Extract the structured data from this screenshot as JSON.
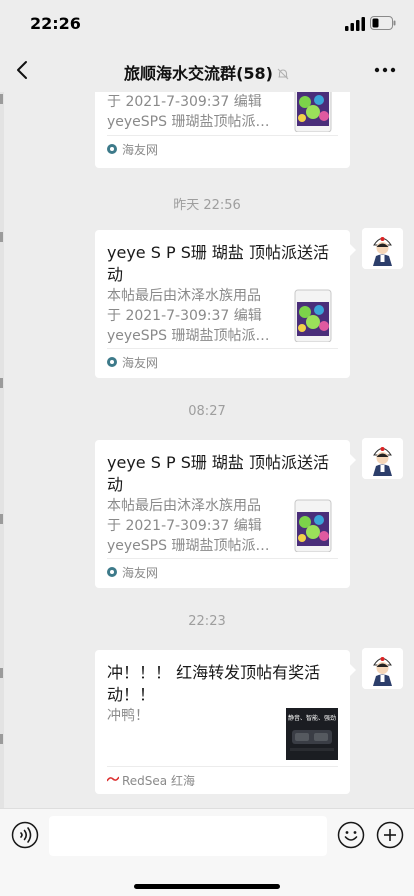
{
  "status_bar": {
    "time": "22:26"
  },
  "header": {
    "title": "旅顺海水交流群",
    "member_count": "(58)"
  },
  "messages": [
    {
      "desc_lines": [
        "于 2021-7-309:37 编辑",
        "yeyeSPS 珊瑚盐顶帖派…"
      ],
      "source": "海友网"
    },
    {
      "timestamp": "昨天 22:56",
      "title": "yeye S P S珊 瑚盐 顶帖派送活动",
      "desc_lines": [
        "本帖最后由沐泽水族用品",
        "于 2021-7-309:37 编辑",
        "yeyeSPS 珊瑚盐顶帖派…"
      ],
      "source": "海友网"
    },
    {
      "timestamp": "08:27",
      "title": "yeye S P S珊 瑚盐 顶帖派送活动",
      "desc_lines": [
        "本帖最后由沐泽水族用品",
        "于 2021-7-309:37 编辑",
        "yeyeSPS 珊瑚盐顶帖派…"
      ],
      "source": "海友网"
    },
    {
      "timestamp": "22:23",
      "title": "冲！！！ 红海转发顶帖有奖活动！！",
      "desc_lines": [
        "冲鸭！"
      ],
      "source": "RedSea 红海",
      "thumb_text": "静音、智能、强劲"
    }
  ],
  "input_bar": {
    "placeholder": ""
  },
  "colors": {
    "background": "#ededed",
    "card": "#ffffff",
    "timestamp": "#9e9e9e",
    "source_icon": "#3d7a8a"
  }
}
